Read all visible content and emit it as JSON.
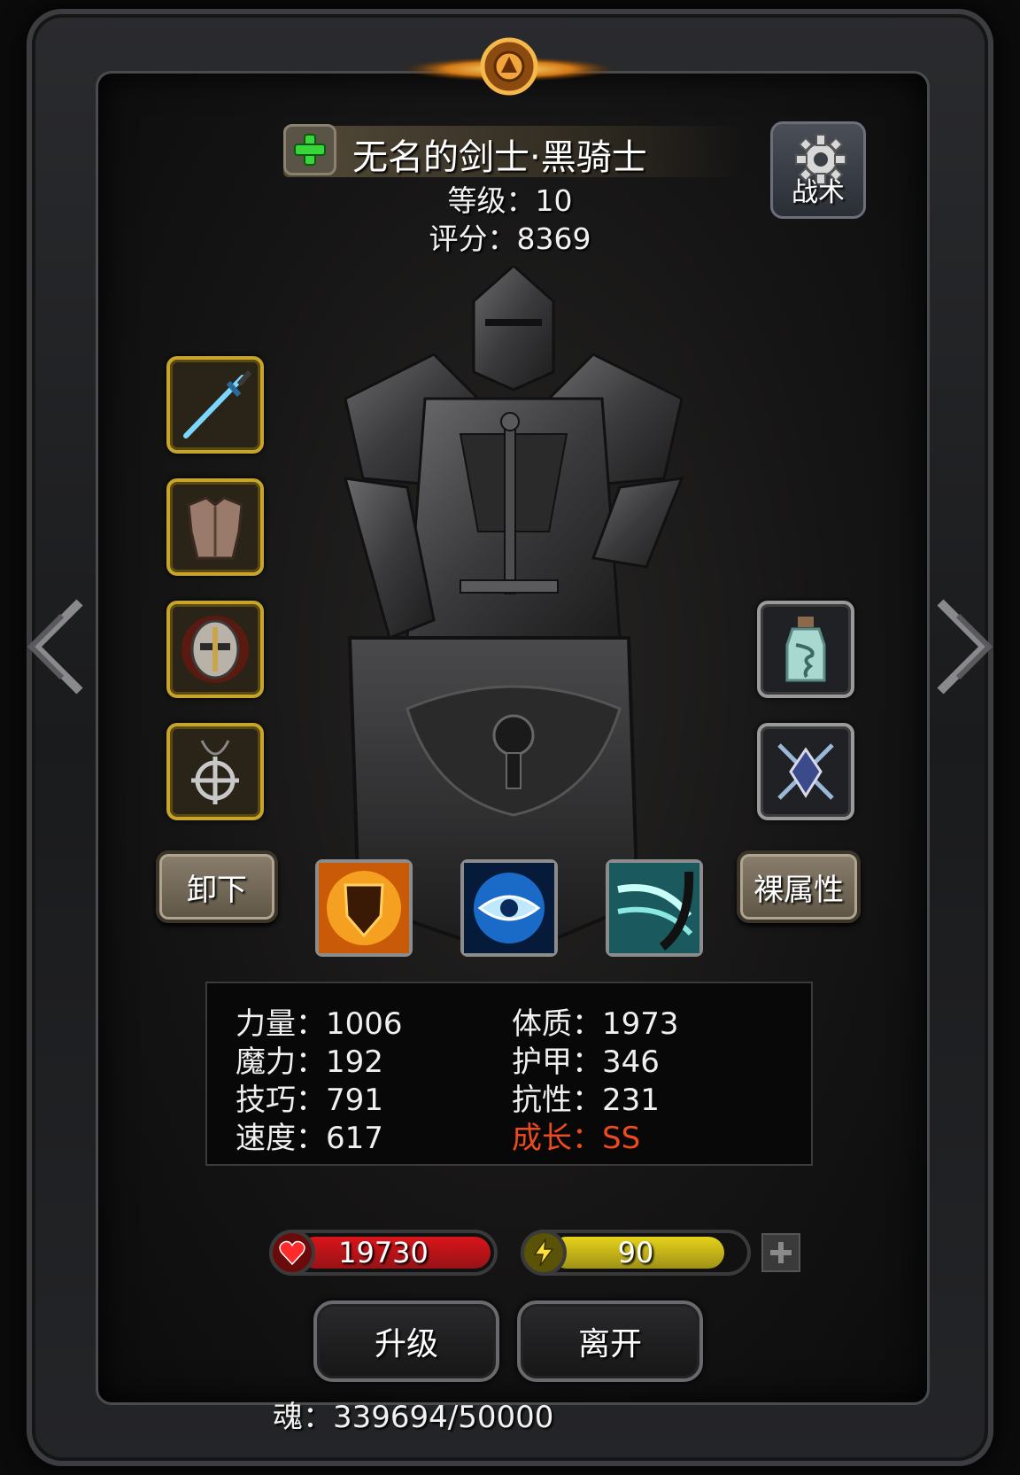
{
  "hero": {
    "name": "无名的剑士·黑骑士",
    "level_text": "等级：10",
    "score_text": "评分：8369"
  },
  "buttons": {
    "tactics": "战术",
    "unequip": "卸下",
    "base_attributes": "裸属性",
    "upgrade": "升级",
    "leave": "离开"
  },
  "equipment_slots": [
    "sword-icon",
    "chest-armor-icon",
    "helmet-icon",
    "amulet-icon"
  ],
  "accessory_slots": [
    "tornado-bottle-icon",
    "crossed-swords-crest-icon"
  ],
  "skills": [
    "flame-shield-icon",
    "eye-orb-icon",
    "wind-slash-icon"
  ],
  "stats": {
    "left": [
      "力量：1006",
      "魔力：192",
      "技巧：791",
      "速度：617"
    ],
    "right": [
      "体质：1973",
      "护甲：346",
      "抗性：231",
      "成长：SS"
    ]
  },
  "hp": {
    "value": "19730",
    "fill": 1.0,
    "color": "#d9141a"
  },
  "energy": {
    "value": "90",
    "fill": 0.9,
    "color": "#e6d21a"
  },
  "soul_text": "魂：339694/50000",
  "colors": {
    "slot_gold": "#c6a52a",
    "growth_red": "#ee4a1e"
  }
}
